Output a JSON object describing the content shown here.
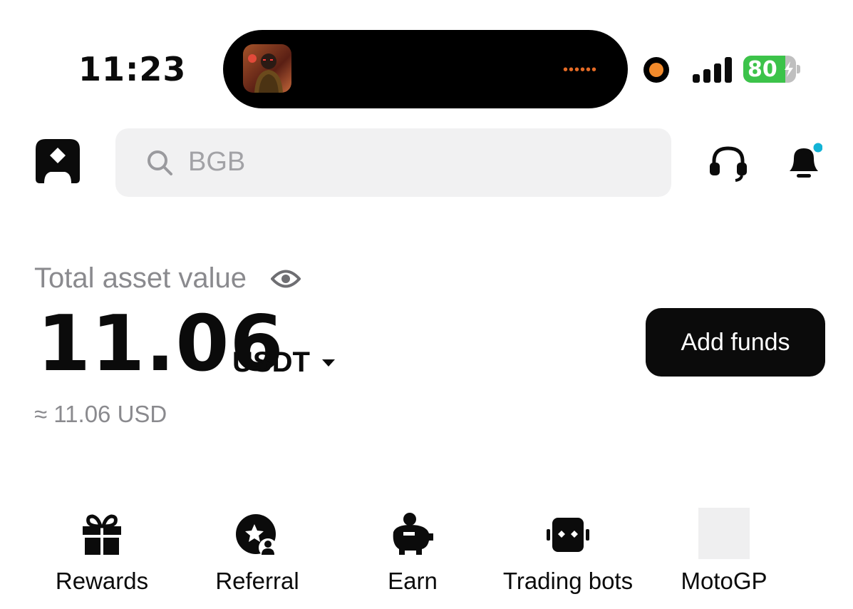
{
  "status_bar": {
    "time": "11:23",
    "battery_percent": 80,
    "battery_label": "80",
    "activity_dots": "••••••",
    "icons": [
      "media-thumbnail",
      "recording-dot-icon",
      "signal-icon",
      "battery-charging-icon"
    ]
  },
  "header": {
    "logo_icon": "bitget-logo-icon",
    "search_placeholder": "BGB",
    "icons": [
      "search-icon",
      "headset-icon",
      "bell-icon"
    ],
    "notification_dot_color": "#12b3d6"
  },
  "balance": {
    "label": "Total asset value",
    "amount": "11.06",
    "currency": "USDT",
    "approx": "≈ 11.06 USD",
    "add_funds_label": "Add funds"
  },
  "quick_menu": [
    {
      "label": "Rewards",
      "icon": "gift-icon"
    },
    {
      "label": "Referral",
      "icon": "referral-star-icon"
    },
    {
      "label": "Earn",
      "icon": "piggy-bank-icon"
    },
    {
      "label": "Trading bots",
      "icon": "robot-icon"
    },
    {
      "label": "MotoGP",
      "icon": "placeholder-icon"
    }
  ],
  "colors": {
    "text": "#0b0b0b",
    "muted": "#8a8a8e",
    "search_bg": "#f1f1f2",
    "battery_green": "#3cc34a",
    "recording_orange": "#f28a2b"
  }
}
